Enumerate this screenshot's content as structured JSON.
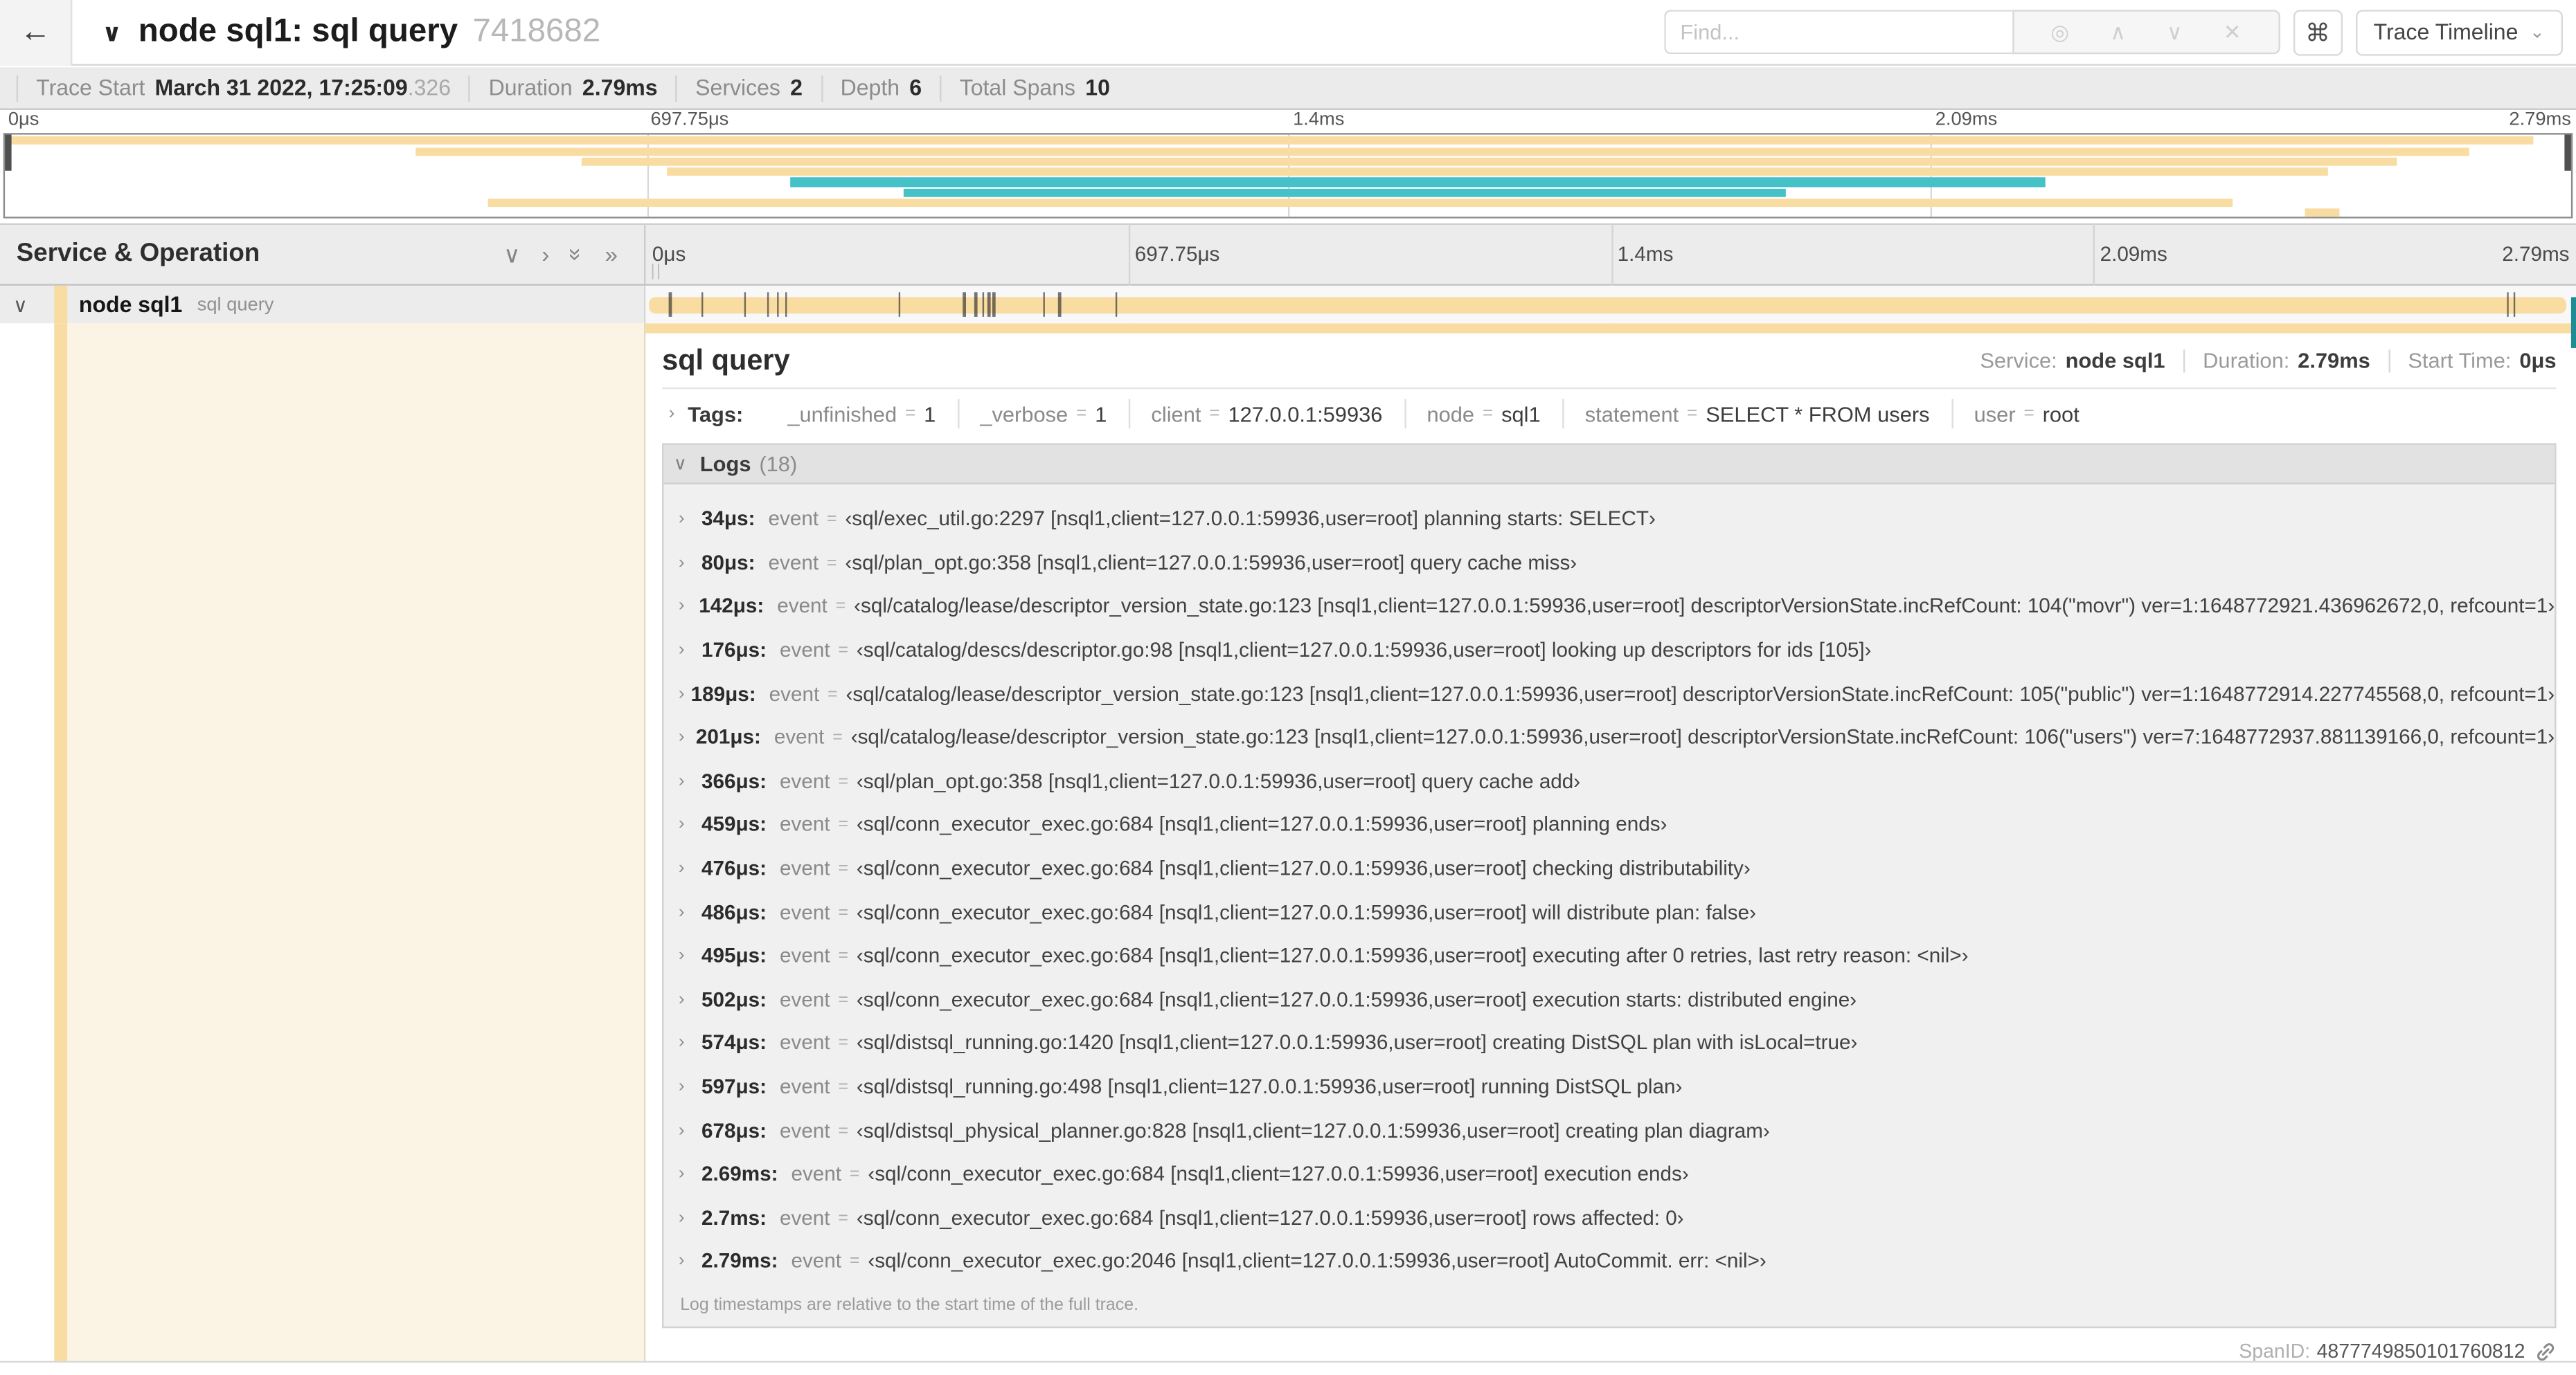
{
  "colors": {
    "span_tan": "#F8DCA1",
    "span_teal": "#44C2C8",
    "detail_cream": "#FBF4E4",
    "accent_edge": "#1E8C94"
  },
  "icons": {
    "back": "←",
    "title_chevron": "∨",
    "find_locate": "◎",
    "find_prev": "∧",
    "find_next": "∨",
    "find_clear": "✕",
    "keyboard": "⌘",
    "select_caret": "⌄",
    "collapse_one": "∨",
    "expand_one": "›",
    "collapse_all": "»",
    "expand_all": "»",
    "row_chevron": "∨",
    "item_chevron": "›",
    "grip": "||"
  },
  "header": {
    "title": "node sql1: sql query",
    "trace_id": "7418682",
    "find_placeholder": "Find...",
    "view_select": "Trace Timeline"
  },
  "meta": {
    "items": [
      {
        "label": "Trace Start",
        "value": "March 31 2022, 17:25:09",
        "suffix": ".326"
      },
      {
        "label": "Duration",
        "value": "2.79ms",
        "suffix": ""
      },
      {
        "label": "Services",
        "value": "2",
        "suffix": ""
      },
      {
        "label": "Depth",
        "value": "6",
        "suffix": ""
      },
      {
        "label": "Total Spans",
        "value": "10",
        "suffix": ""
      }
    ]
  },
  "ruler": {
    "labels": [
      {
        "text": "0μs",
        "pct": 0
      },
      {
        "text": "697.75μs",
        "pct": 25
      },
      {
        "text": "1.4ms",
        "pct": 50
      },
      {
        "text": "2.09ms",
        "pct": 75
      },
      {
        "text": "2.79ms",
        "pct": 100
      }
    ]
  },
  "minimap": {
    "spans": [
      {
        "start_pct": 0,
        "end_pct": 98.5,
        "color": "#F8DCA1",
        "row": 0
      },
      {
        "start_pct": 16,
        "end_pct": 96,
        "color": "#F8DCA1",
        "row": 1
      },
      {
        "start_pct": 22.5,
        "end_pct": 93.2,
        "color": "#F8DCA1",
        "row": 2
      },
      {
        "start_pct": 25.8,
        "end_pct": 90.5,
        "color": "#F8DCA1",
        "row": 3
      },
      {
        "start_pct": 30.6,
        "end_pct": 79.5,
        "color": "#44C2C8",
        "row": 4
      },
      {
        "start_pct": 35,
        "end_pct": 69.4,
        "color": "#44C2C8",
        "row": 5
      },
      {
        "start_pct": 18.8,
        "end_pct": 86.8,
        "color": "#F8DCA1",
        "row": 6
      },
      {
        "start_pct": 89.6,
        "end_pct": 91,
        "color": "#F8DCA1",
        "row": 7
      }
    ]
  },
  "tree": {
    "header": "Service & Operation",
    "row": {
      "service": "node sql1",
      "operation": "sql query"
    }
  },
  "timeline": {
    "duration_us": 2790,
    "ticks_us": [
      34,
      80,
      142,
      176,
      189,
      201,
      366,
      459,
      476,
      486,
      495,
      502,
      574,
      597,
      678,
      2690,
      2700,
      2790
    ]
  },
  "detail": {
    "title": "sql query",
    "service_label": "Service:",
    "service": "node sql1",
    "duration_label": "Duration:",
    "duration": "2.79ms",
    "start_label": "Start Time:",
    "start": "0μs",
    "tags": {
      "label": "Tags:",
      "eq": "=",
      "items": [
        {
          "key": "_unfinished",
          "value": "1"
        },
        {
          "key": "_verbose",
          "value": "1"
        },
        {
          "key": "client",
          "value": "127.0.0.1:59936"
        },
        {
          "key": "node",
          "value": "sql1"
        },
        {
          "key": "statement",
          "value": "SELECT * FROM users"
        },
        {
          "key": "user",
          "value": "root"
        }
      ]
    },
    "logs": {
      "label": "Logs",
      "count": "(18)",
      "eq": "=",
      "key": "event",
      "entries": [
        {
          "time": "34μs:",
          "value": "‹sql/exec_util.go:2297 [nsql1,client=127.0.0.1:59936,user=root] planning starts: SELECT›"
        },
        {
          "time": "80μs:",
          "value": "‹sql/plan_opt.go:358 [nsql1,client=127.0.0.1:59936,user=root] query cache miss›"
        },
        {
          "time": "142μs:",
          "value": "‹sql/catalog/lease/descriptor_version_state.go:123 [nsql1,client=127.0.0.1:59936,user=root] descriptorVersionState.incRefCount: 104(\"movr\") ver=1:1648772921.436962672,0, refcount=1›"
        },
        {
          "time": "176μs:",
          "value": "‹sql/catalog/descs/descriptor.go:98 [nsql1,client=127.0.0.1:59936,user=root] looking up descriptors for ids [105]›"
        },
        {
          "time": "189μs:",
          "value": "‹sql/catalog/lease/descriptor_version_state.go:123 [nsql1,client=127.0.0.1:59936,user=root] descriptorVersionState.incRefCount: 105(\"public\") ver=1:1648772914.227745568,0, refcount=1›"
        },
        {
          "time": "201μs:",
          "value": "‹sql/catalog/lease/descriptor_version_state.go:123 [nsql1,client=127.0.0.1:59936,user=root] descriptorVersionState.incRefCount: 106(\"users\") ver=7:1648772937.881139166,0, refcount=1›"
        },
        {
          "time": "366μs:",
          "value": "‹sql/plan_opt.go:358 [nsql1,client=127.0.0.1:59936,user=root] query cache add›"
        },
        {
          "time": "459μs:",
          "value": "‹sql/conn_executor_exec.go:684 [nsql1,client=127.0.0.1:59936,user=root] planning ends›"
        },
        {
          "time": "476μs:",
          "value": "‹sql/conn_executor_exec.go:684 [nsql1,client=127.0.0.1:59936,user=root] checking distributability›"
        },
        {
          "time": "486μs:",
          "value": "‹sql/conn_executor_exec.go:684 [nsql1,client=127.0.0.1:59936,user=root] will distribute plan: false›"
        },
        {
          "time": "495μs:",
          "value": "‹sql/conn_executor_exec.go:684 [nsql1,client=127.0.0.1:59936,user=root] executing after 0 retries, last retry reason: <nil>›"
        },
        {
          "time": "502μs:",
          "value": "‹sql/conn_executor_exec.go:684 [nsql1,client=127.0.0.1:59936,user=root] execution starts: distributed engine›"
        },
        {
          "time": "574μs:",
          "value": "‹sql/distsql_running.go:1420 [nsql1,client=127.0.0.1:59936,user=root] creating DistSQL plan with isLocal=true›"
        },
        {
          "time": "597μs:",
          "value": "‹sql/distsql_running.go:498 [nsql1,client=127.0.0.1:59936,user=root] running DistSQL plan›"
        },
        {
          "time": "678μs:",
          "value": "‹sql/distsql_physical_planner.go:828 [nsql1,client=127.0.0.1:59936,user=root] creating plan diagram›"
        },
        {
          "time": "2.69ms:",
          "value": "‹sql/conn_executor_exec.go:684 [nsql1,client=127.0.0.1:59936,user=root] execution ends›"
        },
        {
          "time": "2.7ms:",
          "value": "‹sql/conn_executor_exec.go:684 [nsql1,client=127.0.0.1:59936,user=root] rows affected: 0›"
        },
        {
          "time": "2.79ms:",
          "value": "‹sql/conn_executor_exec.go:2046 [nsql1,client=127.0.0.1:59936,user=root] AutoCommit. err: <nil>›"
        }
      ],
      "footer": "Log timestamps are relative to the start time of the full trace."
    },
    "span_id_label": "SpanID:",
    "span_id": "4877749850101760812"
  }
}
